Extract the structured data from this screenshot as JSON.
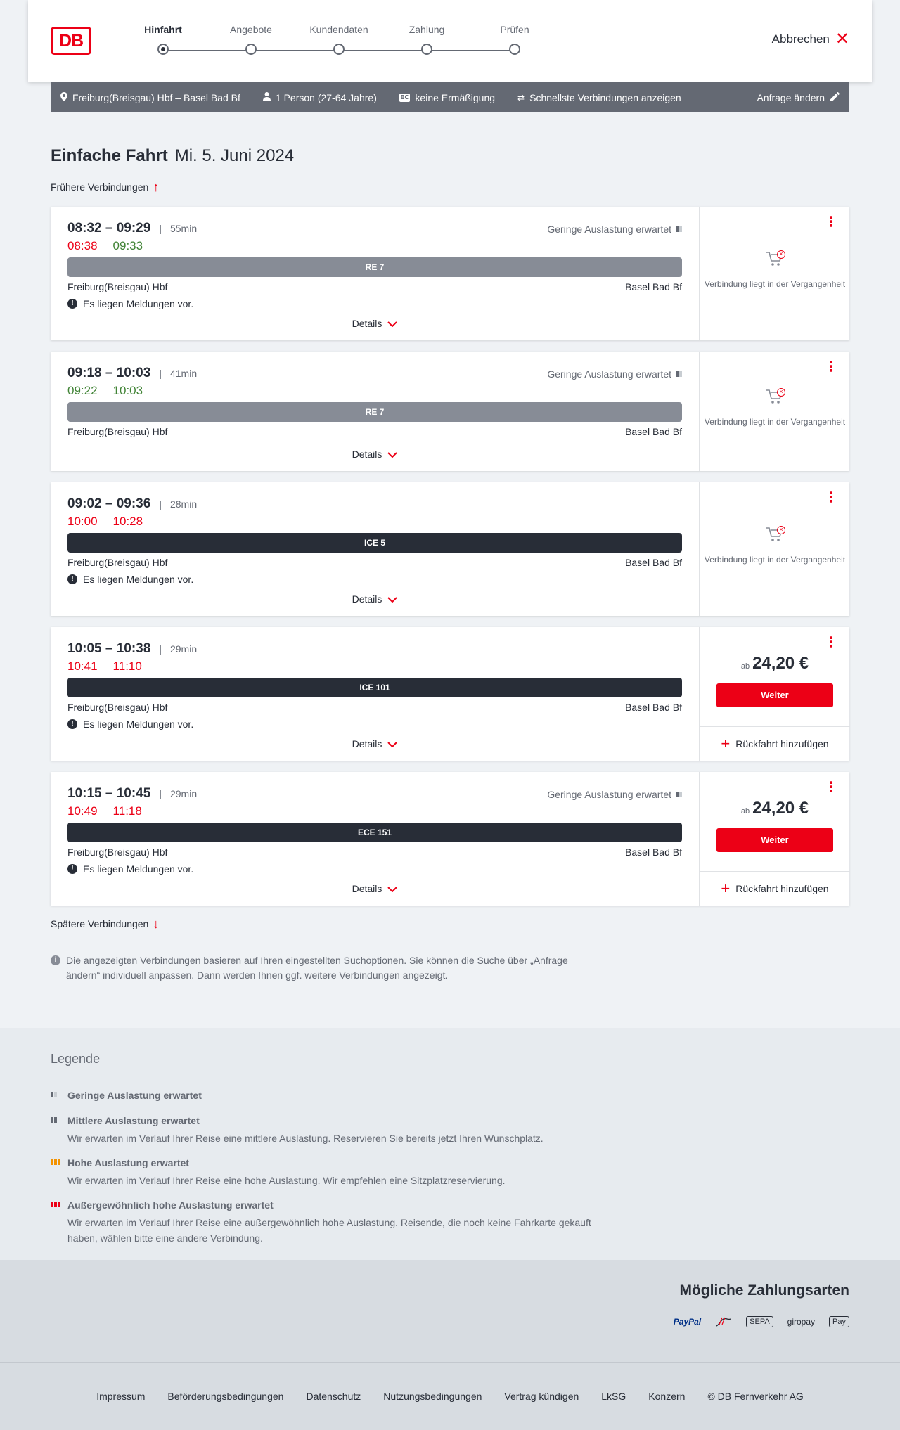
{
  "header": {
    "logo": "DB",
    "steps": [
      "Hinfahrt",
      "Angebote",
      "Kundendaten",
      "Zahlung",
      "Prüfen"
    ],
    "active_step": 0,
    "cancel": "Abbrechen"
  },
  "search": {
    "route": "Freiburg(Breisgau) Hbf – Basel Bad Bf",
    "passengers": "1 Person (27-64 Jahre)",
    "discount_badge": "BC",
    "discount": "keine Ermäßigung",
    "fastest": "Schnellste Verbindungen anzeigen",
    "edit": "Anfrage ändern"
  },
  "page": {
    "title": "Einfache Fahrt",
    "date": "Mi. 5. Juni 2024",
    "earlier": "Frühere Verbindungen",
    "later": "Spätere Verbindungen",
    "details": "Details",
    "past_text": "Verbindung liegt in der Vergangenheit",
    "price_prefix": "ab",
    "continue": "Weiter",
    "return": "Rückfahrt hinzufügen",
    "messages": "Es liegen Meldungen vor.",
    "info": "Die angezeigten Verbindungen basieren auf Ihren eingestellten Suchoptionen. Sie können die Suche über „Anfrage ändern“ individuell anpassen. Dann werden Ihnen ggf. weitere Verbindungen angezeigt."
  },
  "connections": [
    {
      "time": "08:32 – 09:29",
      "duration": "55min",
      "rt_dep": "08:38",
      "rt_arr": "09:33",
      "rt_arr_status": "ontime",
      "load": "Geringe Auslastung erwartet",
      "train": "RE 7",
      "from": "Freiburg(Breisgau) Hbf",
      "to": "Basel Bad Bf"
    },
    {
      "time": "09:18 – 10:03",
      "duration": "41min",
      "rt_dep": "09:22",
      "rt_arr": "10:03",
      "rt_dep_status": "ontime",
      "rt_arr_status": "ontime",
      "load": "Geringe Auslastung erwartet",
      "train": "RE 7",
      "from": "Freiburg(Breisgau) Hbf",
      "to": "Basel Bad Bf"
    },
    {
      "time": "09:02 – 09:36",
      "duration": "28min",
      "rt_dep": "10:00",
      "rt_arr": "10:28",
      "load": "",
      "train": "ICE 5",
      "from": "Freiburg(Breisgau) Hbf",
      "to": "Basel Bad Bf"
    },
    {
      "time": "10:05 – 10:38",
      "duration": "29min",
      "rt_dep": "10:41",
      "rt_arr": "11:10",
      "load": "",
      "train": "ICE 101",
      "from": "Freiburg(Breisgau) Hbf",
      "to": "Basel Bad Bf",
      "price": "24,20 €"
    },
    {
      "time": "10:15 – 10:45",
      "duration": "29min",
      "rt_dep": "10:49",
      "rt_arr": "11:18",
      "load": "Geringe Auslastung erwartet",
      "train": "ECE 151",
      "from": "Freiburg(Breisgau) Hbf",
      "to": "Basel Bad Bf",
      "price": "24,20 €"
    }
  ],
  "legend": {
    "title": "Legende",
    "items": [
      {
        "title": "Geringe Auslastung erwartet",
        "desc": "",
        "color": "#646973",
        "level": 1
      },
      {
        "title": "Mittlere Auslastung erwartet",
        "desc": "Wir erwarten im Verlauf Ihrer Reise eine mittlere Auslastung. Reservieren Sie bereits jetzt Ihren Wunschplatz.",
        "color": "#646973",
        "level": 2
      },
      {
        "title": "Hohe Auslastung erwartet",
        "desc": "Wir erwarten im Verlauf Ihrer Reise eine hohe Auslastung. Wir empfehlen eine Sitzplatzreservierung.",
        "color": "#f39200",
        "level": 3
      },
      {
        "title": "Außergewöhnlich hohe Auslastung erwartet",
        "desc": "Wir erwarten im Verlauf Ihrer Reise eine außergewöhnlich hohe Auslastung. Reisende, die noch keine Fahrkarte gekauft haben, wählen bitte eine andere Verbindung.",
        "color": "#ec0016",
        "level": 4
      }
    ]
  },
  "payment": {
    "title": "Mögliche Zahlungsarten",
    "methods": [
      "PayPal",
      "Kreditkarte",
      "SEPA",
      "giropay",
      "Apple Pay"
    ],
    "labels": {
      "paypal": "PayPal",
      "sepa": "SEPA",
      "giropay": "giropay",
      "applepay": "Pay"
    }
  },
  "footer": [
    "Impressum",
    "Beförderungsbedingungen",
    "Datenschutz",
    "Nutzungsbedingungen",
    "Vertrag kündigen",
    "LkSG",
    "Konzern",
    "© DB Fernverkehr AG"
  ],
  "colors": {
    "brand": "#ec0016",
    "ontime": "#408335",
    "late": "#ec0016"
  }
}
